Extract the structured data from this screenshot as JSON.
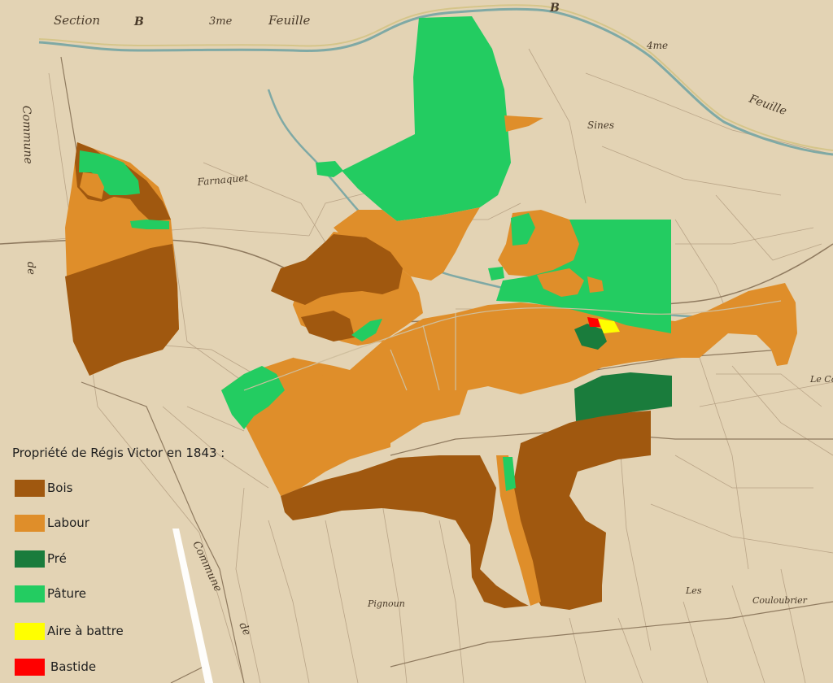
{
  "legend": {
    "title": "Propriété de Régis Victor en 1843 :",
    "items": [
      {
        "label": "Bois",
        "color": "#a0580f"
      },
      {
        "label": "Labour",
        "color": "#df8e2a"
      },
      {
        "label": "Pré",
        "color": "#1a7c3c"
      },
      {
        "label": "Pâture",
        "color": "#23cc61"
      },
      {
        "label": "Aire à battre",
        "color": "#ffff00"
      },
      {
        "label": "Bastide",
        "color": "#ff0000"
      }
    ]
  },
  "cadastre_labels": {
    "section": "Section",
    "section_letter_left": "B",
    "third_sheet": "3me",
    "feuille_top": "Feuille",
    "b_right": "B",
    "fourth_sheet": "4me",
    "feuille_right": "Feuille",
    "commune_left": "Commune",
    "de_left": "de",
    "farnaquet": "Farnaquet",
    "sines": "Sines",
    "commune_bottom": "Commune",
    "de_bottom": "de",
    "pignoun": "Pignoun",
    "les": "Les",
    "couloubrier": "Couloubrier",
    "le_co": "Le Co"
  },
  "colors": {
    "paper": "#e3d3b4",
    "bois": "#a0580f",
    "labour": "#df8e2a",
    "pre": "#1a7c3c",
    "pature": "#23cc61",
    "aire": "#ffff00",
    "bastide": "#ff0000"
  }
}
